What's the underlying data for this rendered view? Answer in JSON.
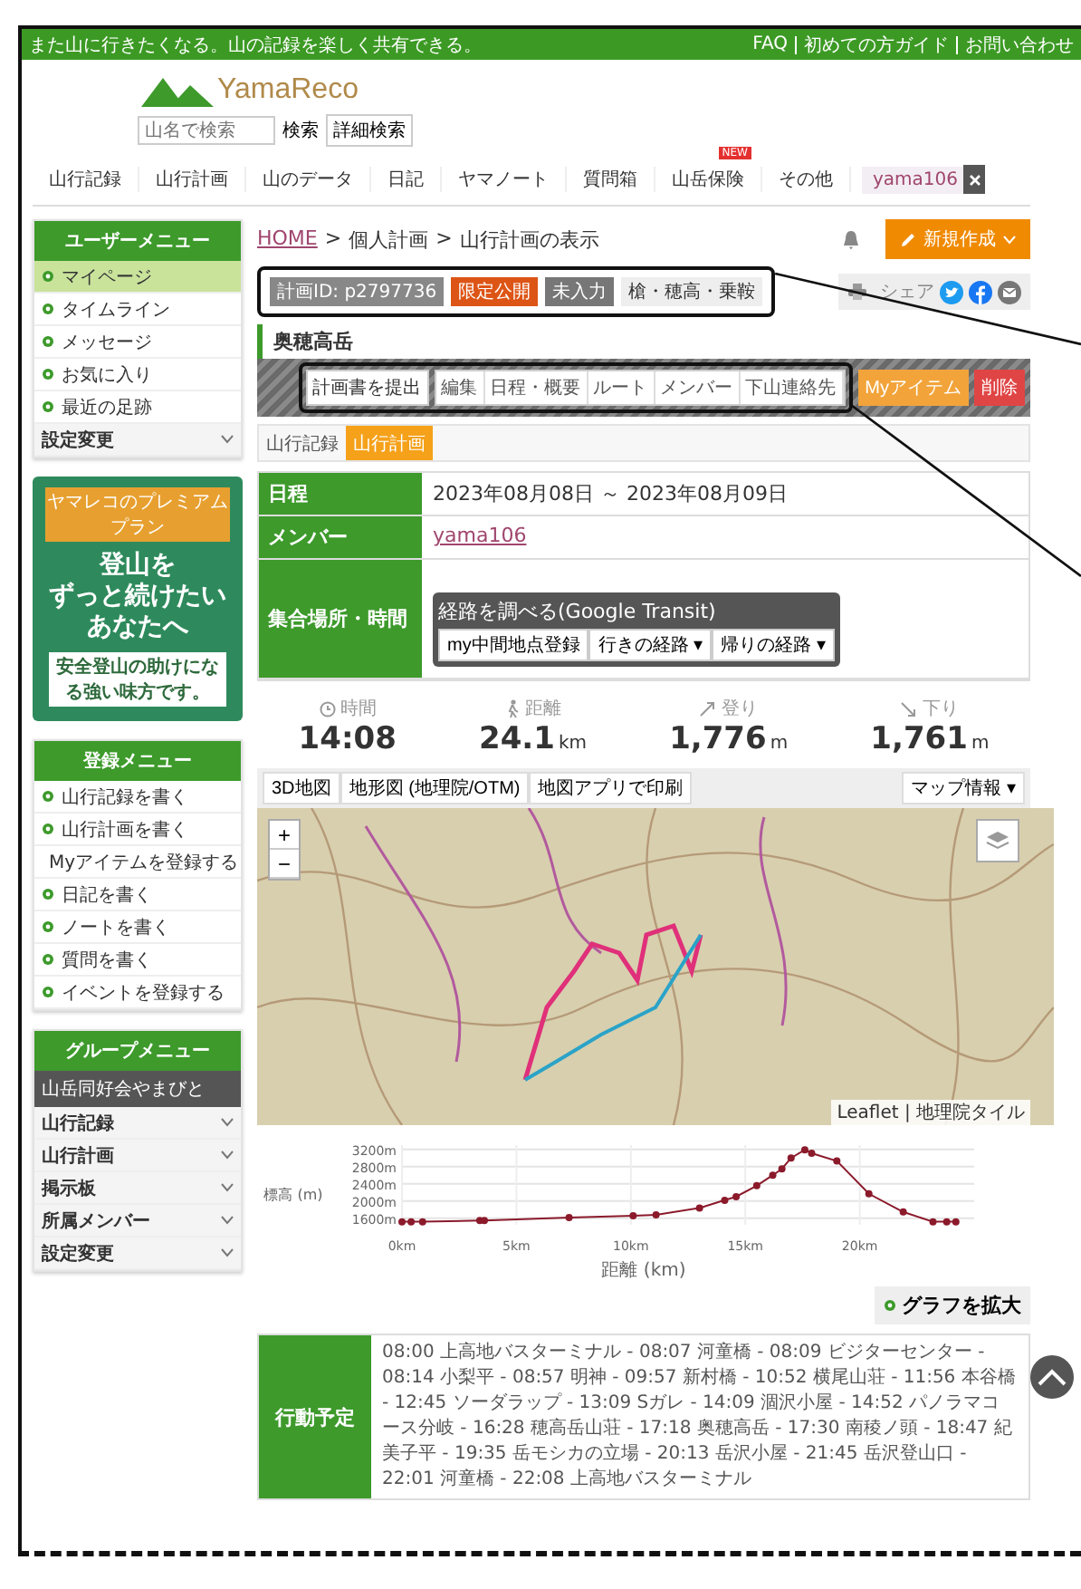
{
  "header": {
    "tagline": "また山に行きたくなる。山の記録を楽しく共有できる。",
    "links": [
      "FAQ",
      "初めての方ガイド",
      "お問い合わせ"
    ]
  },
  "logo": {
    "text": "YamaReco"
  },
  "search": {
    "placeholder": "山名で検索",
    "buttons": [
      "検索",
      "詳細検索"
    ]
  },
  "nav": [
    {
      "label": "山行記録"
    },
    {
      "label": "山行計画"
    },
    {
      "label": "山のデータ"
    },
    {
      "label": "日記"
    },
    {
      "label": "ヤマノート"
    },
    {
      "label": "質問箱"
    },
    {
      "label": "山岳保険",
      "badge": "NEW"
    },
    {
      "label": "その他"
    }
  ],
  "user": {
    "name": "yama106"
  },
  "sidebar": {
    "user_menu": {
      "title": "ユーザーメニュー",
      "items": [
        {
          "label": "マイページ",
          "selected": true,
          "kind": "link"
        },
        {
          "label": "タイムライン",
          "selected": false,
          "kind": "link"
        },
        {
          "label": "メッセージ",
          "selected": false,
          "kind": "link"
        },
        {
          "label": "お気に入り",
          "selected": false,
          "kind": "link"
        },
        {
          "label": "最近の足跡",
          "selected": false,
          "kind": "link"
        },
        {
          "label": "設定変更",
          "selected": false,
          "kind": "dropdown"
        }
      ]
    },
    "banner": {
      "ribbon": "ヤマレコのプレミアムプラン",
      "headline": [
        "登山を",
        "ずっと続けたい",
        "あなたへ"
      ],
      "sub": "安全登山の助けになる強い味方です。"
    },
    "register_menu": {
      "title": "登録メニュー",
      "items": [
        {
          "label": "山行記録を書く",
          "kind": "link"
        },
        {
          "label": "山行計画を書く",
          "kind": "link"
        },
        {
          "label": "Myアイテムを登録する",
          "kind": "link"
        },
        {
          "label": "日記を書く",
          "kind": "link"
        },
        {
          "label": "ノートを書く",
          "kind": "link"
        },
        {
          "label": "質問を書く",
          "kind": "link"
        },
        {
          "label": "イベントを登録する",
          "kind": "link"
        }
      ]
    },
    "group_menu": {
      "title": "グループメニュー",
      "group": "山岳同好会やまびと",
      "items": [
        {
          "label": "山行記録",
          "kind": "dropdown"
        },
        {
          "label": "山行計画",
          "kind": "dropdown"
        },
        {
          "label": "掲示板",
          "kind": "dropdown"
        },
        {
          "label": "所属メンバー",
          "kind": "dropdown"
        },
        {
          "label": "設定変更",
          "kind": "dropdown"
        }
      ]
    }
  },
  "main": {
    "breadcrumb": [
      {
        "label": "HOME",
        "link": true
      },
      {
        "label": ">",
        "link": false
      },
      {
        "label": "個人計画",
        "link": false
      },
      {
        "label": ">",
        "link": false
      },
      {
        "label": "山行計画の表示",
        "link": false
      }
    ],
    "new_button": "新規作成",
    "tags": {
      "annotated": true,
      "items": [
        {
          "label": "計画ID: p2797736",
          "kind": "id"
        },
        {
          "label": "限定公開",
          "kind": "visibility"
        },
        {
          "label": "未入力",
          "kind": "status"
        },
        {
          "label": "槍・穂高・乗鞍",
          "kind": "area"
        }
      ]
    },
    "share_label": "シェア",
    "title": "奥穂高岳",
    "actions": {
      "annotated": true,
      "items": [
        {
          "label": "計画書を提出",
          "kind": "boxed"
        },
        {
          "label": "編集",
          "kind": "group"
        },
        {
          "label": "日程・概要",
          "kind": "group"
        },
        {
          "label": "ルート",
          "kind": "group"
        },
        {
          "label": "メンバー",
          "kind": "group"
        },
        {
          "label": "下山連絡先",
          "kind": "group"
        },
        {
          "label": "Myアイテム",
          "kind": "item"
        },
        {
          "label": "削除",
          "kind": "danger"
        }
      ]
    },
    "tabs": [
      {
        "label": "山行記録",
        "selected": false
      },
      {
        "label": "山行計画",
        "selected": true
      }
    ],
    "details": [
      {
        "label": "日程",
        "kind": "text",
        "value": "2023年08月08日 ～ 2023年08月09日"
      },
      {
        "label": "メンバー",
        "kind": "link",
        "value": "yama106"
      },
      {
        "label": "集合場所・時間",
        "kind": "transit",
        "title": "経路を調べる(Google Transit)",
        "buttons": [
          "my中間地点登録",
          "行きの経路 ▾",
          "帰りの経路 ▾"
        ]
      }
    ],
    "stats": [
      {
        "kind": "time",
        "label": "時間",
        "value": "14:08"
      },
      {
        "kind": "distance",
        "label": "距離",
        "value": "24.1",
        "unit": "km"
      },
      {
        "kind": "up",
        "label": "登り",
        "value": "1,776",
        "unit": "m"
      },
      {
        "kind": "down",
        "label": "下り",
        "value": "1,761",
        "unit": "m"
      }
    ],
    "map": {
      "buttons": [
        "3D地図",
        "地形図 (地理院/OTM)",
        "地図アプリで印刷"
      ],
      "info": "マップ情報 ▾",
      "zoom": [
        "+",
        "−"
      ],
      "attribution": "Leaflet | 地理院タイル"
    },
    "chart_data": {
      "type": "line",
      "xlabel": "距離 (km)",
      "ylabel": "標高 (m)",
      "xlim": [
        0,
        25
      ],
      "ylim": [
        1450,
        3300
      ],
      "grid": true,
      "xticks": [
        {
          "value": 0,
          "label": "0km"
        },
        {
          "value": 5,
          "label": "5km"
        },
        {
          "value": 10,
          "label": "10km"
        },
        {
          "value": 15,
          "label": "15km"
        },
        {
          "value": 20,
          "label": "20km"
        }
      ],
      "yticks": [
        {
          "value": 1600,
          "label": "1600m"
        },
        {
          "value": 2000,
          "label": "2000m"
        },
        {
          "value": 2400,
          "label": "2400m"
        },
        {
          "value": 2800,
          "label": "2800m"
        },
        {
          "value": 3200,
          "label": "3200m"
        }
      ],
      "x": [
        0,
        0.4,
        0.9,
        3.4,
        3.6,
        7.3,
        10.1,
        11.1,
        13.0,
        14.1,
        14.6,
        15.5,
        16.2,
        16.6,
        17.0,
        17.6,
        17.9,
        19.0,
        20.4,
        21.9,
        23.2,
        23.8,
        24.2
      ],
      "series": [
        {
          "color": "#8b1a2b",
          "marker": "circle",
          "values": [
            1520,
            1520,
            1520,
            1550,
            1550,
            1620,
            1660,
            1680,
            1840,
            2020,
            2100,
            2360,
            2600,
            2750,
            3000,
            3190,
            3110,
            2930,
            2170,
            1750,
            1520,
            1520,
            1520
          ]
        }
      ]
    },
    "expand_button": "グラフを拡大",
    "schedule": {
      "label": "行動予定",
      "text": "08:00 上高地バスターミナル - 08:07 河童橋 - 08:09 ビジターセンター - 08:14 小梨平 - 08:57 明神 - 09:57 新村橋 - 10:52 横尾山荘 - 11:56 本谷橋 - 12:45 ソーダラップ - 13:09 Sガレ - 14:09 涸沢小屋 - 14:52 パノラマコース分岐 - 16:28 穂高岳山荘 - 17:18 奥穂高岳 - 17:30 南稜ノ頭 - 18:47 紀美子平 - 19:35 岳モシカの立場 - 20:13 岳沢小屋 - 21:45 岳沢登山口 - 22:01 河童橋 - 22:08 上高地バスターミナル"
    }
  }
}
